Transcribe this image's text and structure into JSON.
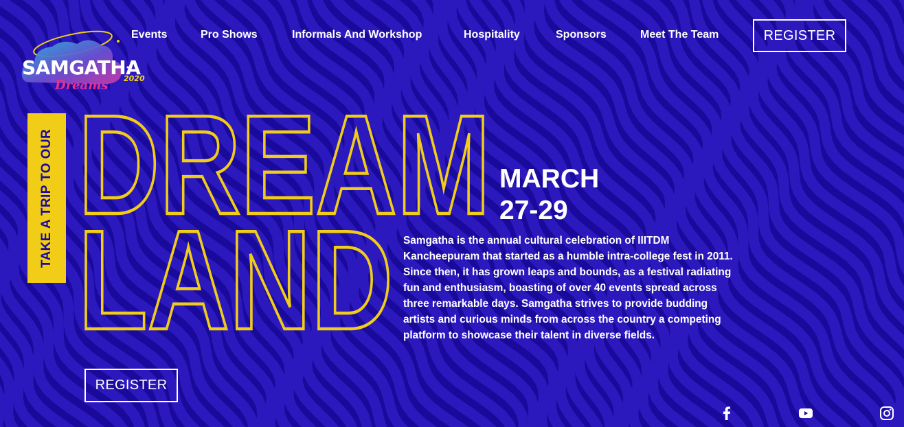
{
  "colors": {
    "background": "#1a0a9c",
    "swirl": "#2e1cc4",
    "accent": "#f1cd17",
    "text": "#ffffff"
  },
  "logo": {
    "main": "SAMGATHA",
    "script": "Dreams",
    "year": "2020"
  },
  "nav": {
    "items": [
      "Events",
      "Pro Shows",
      "Informals And Workshop",
      "Hospitality",
      "Sponsors",
      "Meet The Team"
    ],
    "register_label": "REGISTER"
  },
  "hero": {
    "banner_text": "TAKE A TRIP TO OUR",
    "line1": "DREAM",
    "line2": "LAND",
    "date_month": "MARCH",
    "date_days": "27-29",
    "description": "Samgatha is the annual cultural celebration of IIITDM Kancheepuram that started as a humble intra-college fest in 2011. Since then, it has grown leaps and bounds, as a festival radiating fun and enthusiasm, boasting of over 40 events spread across three remarkable days. Samgatha strives to provide budding artists and curious minds from across the country a competing platform to showcase their talent in diverse fields.",
    "register_label": "REGISTER"
  },
  "social": [
    "facebook-icon",
    "youtube-icon",
    "instagram-icon"
  ]
}
